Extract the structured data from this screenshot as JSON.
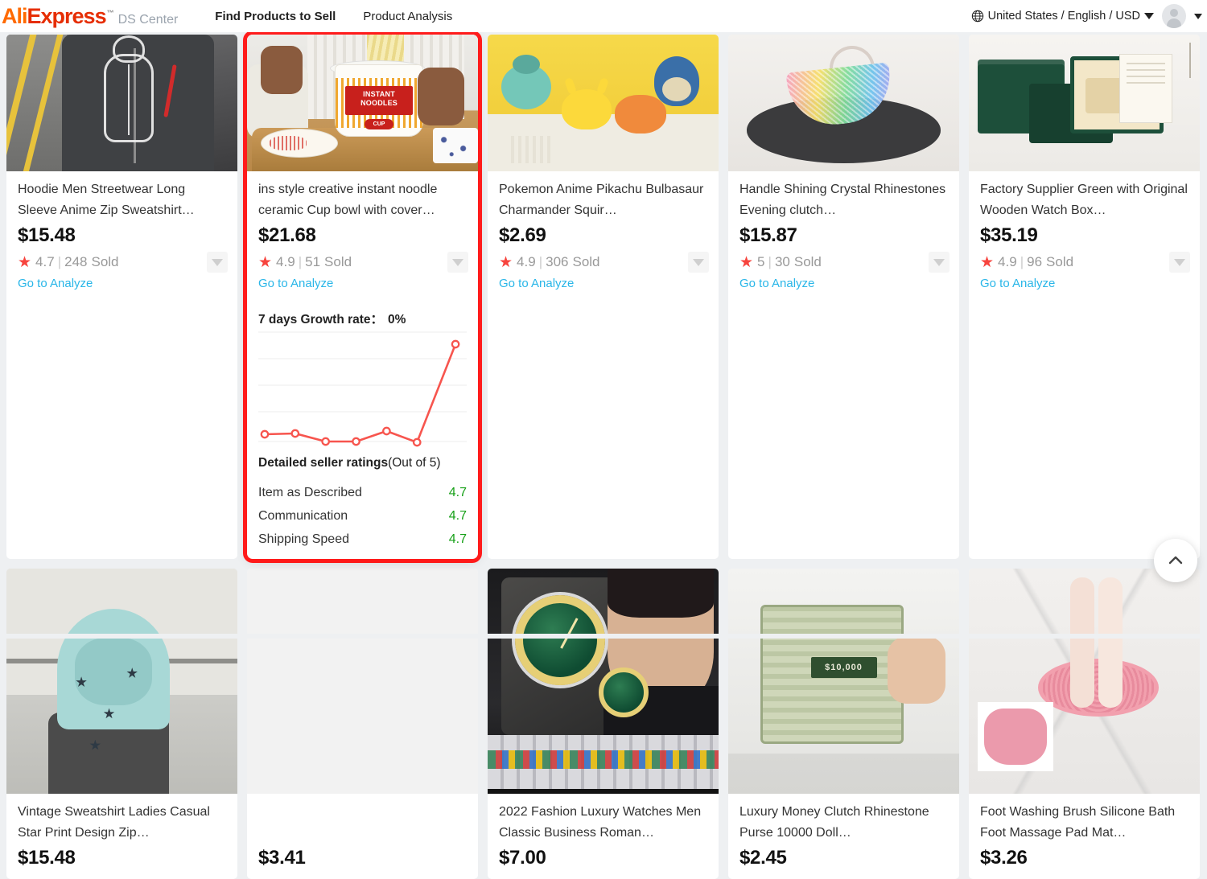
{
  "header": {
    "logo_ali": "Ali",
    "logo_express": "Express",
    "logo_tm": "™",
    "logo_sub": "DS Center",
    "nav": [
      {
        "label": "Find Products to Sell",
        "active": true
      },
      {
        "label": "Product Analysis",
        "active": false
      }
    ],
    "locale": "United States / English / USD",
    "globe_icon": "globe-icon",
    "locale_caret_icon": "chevron-down-icon",
    "avatar_icon": "avatar-icon",
    "account_caret_icon": "chevron-down-icon"
  },
  "labels": {
    "go_to_analyze": "Go to Analyze",
    "sold_suffix": "Sold",
    "star_icon": "star-icon",
    "expand_icon": "chevron-down-icon",
    "to_top_icon": "chevron-up-icon"
  },
  "colors": {
    "accent_red": "#f7443e",
    "link_blue": "#29b6e8",
    "score_green": "#17a018",
    "highlight_border": "#ff1b1b",
    "logo_orange": "#ff6a00",
    "logo_red": "#e62e04",
    "page_bg": "#eef0f2"
  },
  "products": [
    {
      "title": "Hoodie Men Streetwear Long Sleeve Anime Zip Sweatshirt…",
      "price": "$15.48",
      "rating": "4.7",
      "sold": "248",
      "image": "hoodie-men-streetwear",
      "expanded": false
    },
    {
      "title": "ins style creative instant noodle ceramic Cup bowl with cover…",
      "price": "$21.68",
      "rating": "4.9",
      "sold": "51",
      "image": "instant-noodle-ceramic-cup",
      "expanded": true,
      "growth_label": "7 days Growth rate：",
      "growth_value": "0%",
      "dsr_title_bold": "Detailed seller ratings",
      "dsr_title_rest": "(Out of 5)",
      "dsr": [
        {
          "label": "Item as Described",
          "score": "4.7"
        },
        {
          "label": "Communication",
          "score": "4.7"
        },
        {
          "label": "Shipping Speed",
          "score": "4.7"
        }
      ]
    },
    {
      "title": "Pokemon Anime Pikachu Bulbasaur Charmander Squir…",
      "price": "$2.69",
      "rating": "4.9",
      "sold": "306",
      "image": "pokemon-figures",
      "expanded": false
    },
    {
      "title": "Handle Shining Crystal Rhinestones Evening clutch…",
      "price": "$15.87",
      "rating": "5",
      "sold": "30",
      "image": "crystal-evening-clutch",
      "expanded": false
    },
    {
      "title": "Factory Supplier Green with Original Wooden Watch Box…",
      "price": "$35.19",
      "rating": "4.9",
      "sold": "96",
      "image": "green-wooden-watch-box",
      "expanded": false
    },
    {
      "title": "Vintage Sweatshirt Ladies Casual Star Print Design Zip…",
      "price": "$15.48",
      "image": "vintage-star-sweatshirt",
      "expanded": false
    },
    {
      "title": "",
      "price": "$3.41",
      "image": "",
      "expanded": false
    },
    {
      "title": "2022 Fashion Luxury Watches Men Classic Business Roman…",
      "price": "$7.00",
      "image": "luxury-watches-men",
      "expanded": false
    },
    {
      "title": "Luxury Money Clutch Rhinestone Purse 10000 Doll…",
      "price": "$2.45",
      "image": "money-clutch-purse",
      "expanded": false
    },
    {
      "title": "Foot Washing Brush Silicone Bath Foot Massage Pad Mat…",
      "price": "$3.26",
      "image": "foot-washing-brush-mat",
      "expanded": false
    }
  ],
  "chart_data": {
    "type": "line",
    "title": "7 days Growth rate",
    "x": [
      1,
      2,
      3,
      4,
      5,
      6,
      7
    ],
    "values": [
      8,
      8,
      2,
      2,
      10,
      0,
      100
    ],
    "series": [
      {
        "name": "Growth rate",
        "values": [
          8,
          8,
          2,
          2,
          10,
          0,
          100
        ]
      }
    ],
    "xlabel": "",
    "ylabel": "",
    "ylim": [
      0,
      100
    ],
    "grid": true,
    "legend": false,
    "line_color": "#f7554e",
    "marker": "circle-open",
    "annotation": "0%"
  }
}
